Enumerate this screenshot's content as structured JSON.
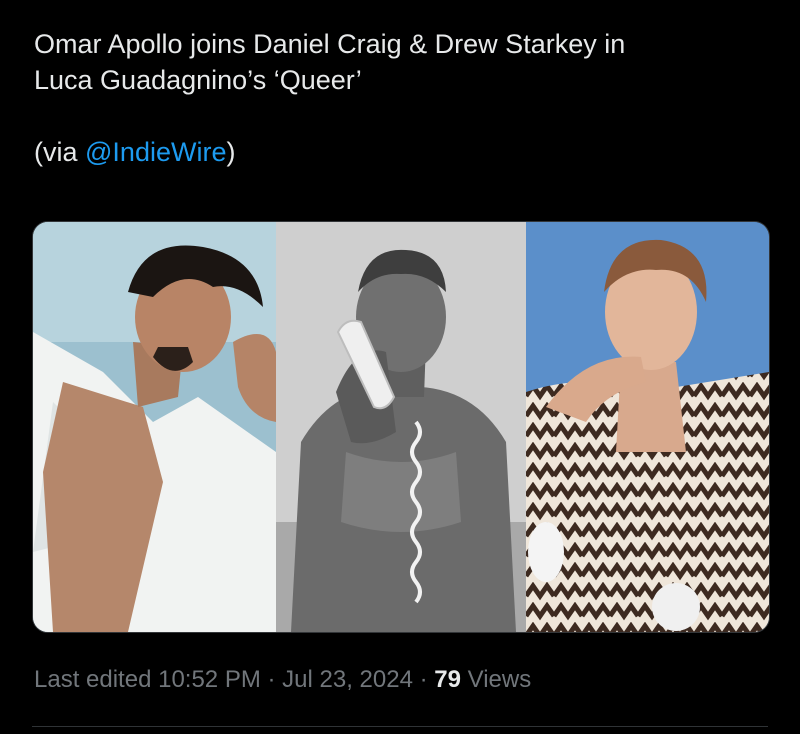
{
  "tweet": {
    "text_line1": "Omar Apollo joins Daniel Craig & Drew Starkey in",
    "text_line2": "Luca Guadagnino’s ‘Queer’",
    "via_prefix": "(via ",
    "via_mention": "@IndieWire",
    "via_suffix": ")",
    "mention_color": "#1d9bf0"
  },
  "media": {
    "photos": [
      {
        "name": "photo-omar-apollo"
      },
      {
        "name": "photo-daniel-craig"
      },
      {
        "name": "photo-drew-starkey"
      }
    ]
  },
  "meta": {
    "edited_label": "Last edited 10:52 PM",
    "sep1": " · ",
    "date": "Jul 23, 2024",
    "sep2": " · ",
    "views_count": "79",
    "views_label": " Views"
  }
}
